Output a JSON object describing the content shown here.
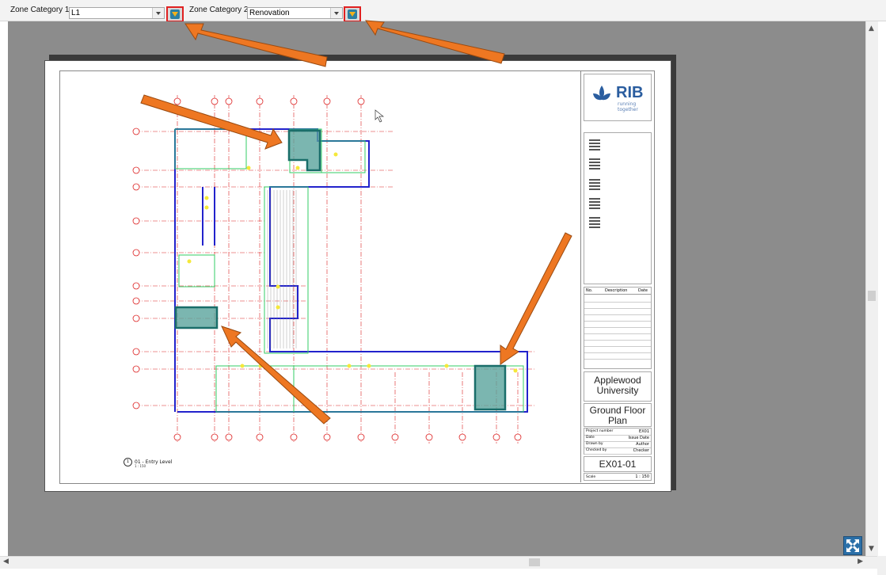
{
  "toolbar": {
    "zone1_label": "Zone Category 1:",
    "zone1_value": "L1",
    "zone2_label": "Zone Category 2:",
    "zone2_value": "Renovation",
    "filter_icon": "filter-icon",
    "dropdown_icon": "chevron-down-icon"
  },
  "sheet": {
    "brand": "RIB",
    "brand_tagline": "running together",
    "revision_headers": [
      "No.",
      "Description",
      "Date"
    ],
    "client_name": "Applewood University",
    "sheet_name": "Ground Floor Plan",
    "meta_rows": [
      {
        "key": "Project number",
        "value": "EX01"
      },
      {
        "key": "Date",
        "value": "Issue Date"
      },
      {
        "key": "Drawn by",
        "value": "Author"
      },
      {
        "key": "Checked by",
        "value": "Checker"
      }
    ],
    "sheet_number": "EX01-01",
    "scale_label": "Scale",
    "scale_value": "1 : 150",
    "view_title": "01 - Entry Level",
    "view_number": "1",
    "view_scale": "1 : 150"
  },
  "colors": {
    "viewport_bg": "#8c8c8c",
    "highlight_border": "#e02020",
    "annotation_arrow": "#ee7722",
    "zone_fill": "#5aa49c",
    "wall_blue": "#2222cc",
    "grid_red": "#dd2222",
    "room_green": "#33cc66"
  },
  "scroll": {
    "up_icon": "▲",
    "down_icon": "▼",
    "left_icon": "◀",
    "right_icon": "▶"
  }
}
